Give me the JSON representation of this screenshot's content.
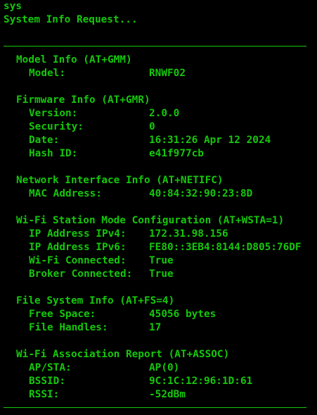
{
  "terminal": {
    "command": "sys",
    "request_line": "System Info Request...",
    "text_color": "#16c60c",
    "background_color": "#000000"
  },
  "sections": [
    {
      "title": "Model Info (AT+GMM)",
      "rows": [
        {
          "key": "Model:",
          "value": "RNWF02"
        }
      ]
    },
    {
      "title": "Firmware Info (AT+GMR)",
      "rows": [
        {
          "key": "Version:",
          "value": "2.0.0"
        },
        {
          "key": "Security:",
          "value": "0"
        },
        {
          "key": "Date:",
          "value": "16:31:26 Apr 12 2024"
        },
        {
          "key": "Hash ID:",
          "value": "e41f977cb"
        }
      ]
    },
    {
      "title": "Network Interface Info (AT+NETIFC)",
      "rows": [
        {
          "key": "MAC Address:",
          "value": "40:84:32:90:23:8D"
        }
      ]
    },
    {
      "title": "Wi-Fi Station Mode Configuration (AT+WSTA=1)",
      "rows": [
        {
          "key": "IP Address IPv4:",
          "value": "172.31.98.156"
        },
        {
          "key": "IP Address IPv6:",
          "value": "FE80::3EB4:8144:D805:76DF"
        },
        {
          "key": "Wi-Fi Connected:",
          "value": "True"
        },
        {
          "key": "Broker Connected:",
          "value": "True"
        }
      ]
    },
    {
      "title": "File System Info (AT+FS=4)",
      "rows": [
        {
          "key": "Free Space:",
          "value": "45056 bytes"
        },
        {
          "key": "File Handles:",
          "value": "17"
        }
      ]
    },
    {
      "title": "Wi-Fi Association Report (AT+ASSOC)",
      "rows": [
        {
          "key": "AP/STA:",
          "value": "AP(0)"
        },
        {
          "key": "BSSID:",
          "value": "9C:1C:12:96:1D:61"
        },
        {
          "key": "RSSI:",
          "value": "-52dBm"
        }
      ]
    }
  ]
}
